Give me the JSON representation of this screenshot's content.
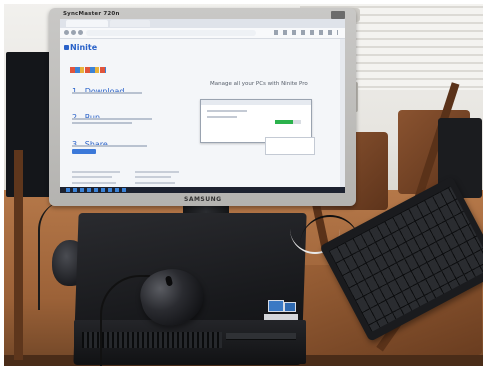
{
  "monitor": {
    "brand_top": "SyncMaster 720n",
    "brand_bottom": "SAMSUNG"
  },
  "screen": {
    "logo": "Ninite",
    "steps": [
      {
        "number": "1.",
        "label": "Download"
      },
      {
        "number": "2.",
        "label": "Run"
      },
      {
        "number": "3.",
        "label": "Share"
      }
    ],
    "headline": "Manage all your PCs with Ninite Pro",
    "installer_progress": 0.7
  }
}
